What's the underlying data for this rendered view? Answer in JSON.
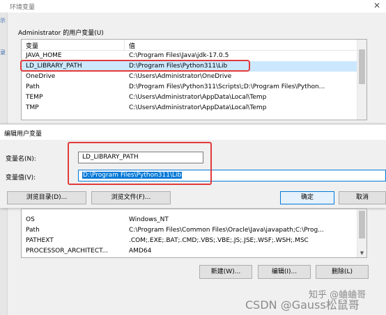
{
  "window": {
    "title": "环境变量",
    "close": "✕"
  },
  "user_group_label": "Administrator 的用户变量(U)",
  "columns": {
    "name": "变量",
    "value": "值"
  },
  "user_vars": [
    {
      "name": "JAVA_HOME",
      "value": "C:\\Program Files\\Java\\jdk-17.0.5"
    },
    {
      "name": "LD_LIBRARY_PATH",
      "value": "D:\\Program Files\\Python311\\Lib"
    },
    {
      "name": "OneDrive",
      "value": "C:\\Users\\Administrator\\OneDrive"
    },
    {
      "name": "Path",
      "value": "D:\\Program Files\\Python311\\Scripts\\;D:\\Program Files\\Python..."
    },
    {
      "name": "TEMP",
      "value": "C:\\Users\\Administrator\\AppData\\Local\\Temp"
    },
    {
      "name": "TMP",
      "value": "C:\\Users\\Administrator\\AppData\\Local\\Temp"
    }
  ],
  "edit_dialog": {
    "title": "编辑用户变量",
    "name_label": "变量名(N):",
    "value_label": "变量值(V):",
    "name_value": "LD_LIBRARY_PATH",
    "value_value": "D:\\Program Files\\Python311\\Lib",
    "browse_dir": "浏览目录(D)...",
    "browse_file": "浏览文件(F)...",
    "ok": "确定",
    "cancel": "取消"
  },
  "system_vars": [
    {
      "name": "OS",
      "value": "Windows_NT"
    },
    {
      "name": "Path",
      "value": "C:\\Program Files\\Common Files\\Oracle\\Java\\javapath;C:\\Prog..."
    },
    {
      "name": "PATHEXT",
      "value": ".COM;.EXE;.BAT;.CMD;.VBS;.VBE;.JS;.JSE;.WSF;.WSH;.MSC"
    },
    {
      "name": "PROCESSOR_ARCHITECT...",
      "value": "AMD64"
    }
  ],
  "system_buttons": {
    "new": "新建(W)...",
    "edit": "编辑(I)...",
    "delete": "删除(L)"
  },
  "watermark": "CSDN @Gauss松鼠哥",
  "watermark2": "知乎 @蛐蛐哥",
  "left_marks": [
    "示",
    "录"
  ]
}
